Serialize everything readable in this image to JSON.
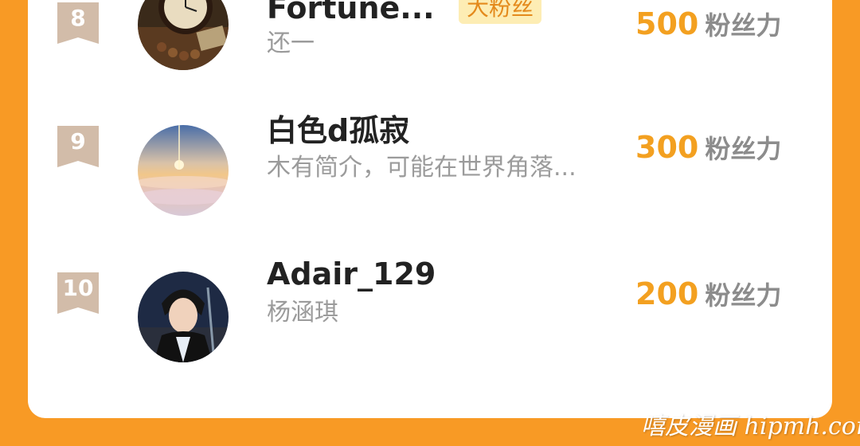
{
  "fans": [
    {
      "rank": "8",
      "name": "Fortune...",
      "tag": "大粉丝",
      "bio": "还一",
      "power_value": "500",
      "power_unit": "粉丝力",
      "avatar_icon": "clock-avatar"
    },
    {
      "rank": "9",
      "name": "白色d孤寂",
      "bio": "木有简介，可能在世界角落...",
      "power_value": "300",
      "power_unit": "粉丝力",
      "avatar_icon": "sunset-sky-avatar"
    },
    {
      "rank": "10",
      "name": "Adair_129",
      "bio": "杨涵琪",
      "power_value": "200",
      "power_unit": "粉丝力",
      "avatar_icon": "anime-character-avatar"
    }
  ],
  "watermark": "嘻皮漫画 hipmh.com",
  "colors": {
    "background": "#f89a25",
    "power": "#f3a020",
    "badge": "#d2bca9",
    "tag_bg": "#fdedb4"
  }
}
